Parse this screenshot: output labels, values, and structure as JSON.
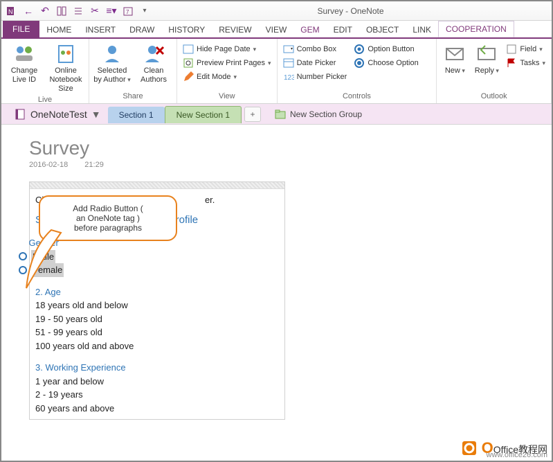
{
  "window": {
    "title": "Survey - OneNote"
  },
  "tabs": {
    "file": "FILE",
    "items": [
      "HOME",
      "INSERT",
      "DRAW",
      "HISTORY",
      "REVIEW",
      "VIEW",
      "GEM",
      "EDIT",
      "OBJECT",
      "LINK",
      "COOPERATION"
    ],
    "active": "COOPERATION"
  },
  "ribbon": {
    "live": {
      "label": "Live",
      "change_id": "Change Live ID",
      "notebook_size": "Online Notebook Size"
    },
    "share": {
      "label": "Share",
      "selected_by": "Selected by Author",
      "clean": "Clean Authors"
    },
    "view": {
      "label": "View",
      "hide_date": "Hide Page Date",
      "preview": "Preview Print Pages",
      "edit_mode": "Edit Mode"
    },
    "controls": {
      "label": "Controls",
      "combo": "Combo Box",
      "date": "Date Picker",
      "number": "Number Picker",
      "option": "Option Button",
      "choose": "Choose Option"
    },
    "outlook": {
      "label": "Outlook",
      "new": "New",
      "reply": "Reply",
      "field": "Field",
      "tasks": "Tasks"
    }
  },
  "sections": {
    "notebook": "OneNoteTest",
    "tab1": "Section 1",
    "tab2": "New Section 1",
    "group": "New Section Group"
  },
  "page": {
    "title": "Survey",
    "date": "2016-02-18",
    "time": "21:29",
    "click_hint_left": "Click",
    "click_hint_right": "er.",
    "section_head_left": "Sectio",
    "section_head_right": "phic and Profile",
    "q1": {
      "head": "Gender",
      "opt1": "Maile",
      "opt2": "Female"
    },
    "q2": {
      "head": "2. Age",
      "l1": "18 years old and below",
      "l2": "19 - 50 years old",
      "l3": "51 - 99 years old",
      "l4": "100 years old and above"
    },
    "q3": {
      "head": "3. Working Experience",
      "l1": "1 year and below",
      "l2": "2 - 19 years",
      "l3": "60 years and above"
    }
  },
  "callout": {
    "line1": "Add Radio Button (",
    "line2": "an OneNote tag )",
    "line3": "before paragraphs"
  },
  "watermark": {
    "text": "Office教程网",
    "url": "www.office26.com"
  }
}
